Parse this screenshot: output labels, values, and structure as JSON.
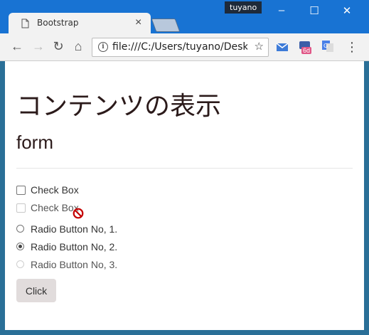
{
  "browser": {
    "tab_title": "Bootstrap",
    "tab_close": "×",
    "user_badge": "tuyano",
    "minimize": "–",
    "maximize": "☐",
    "close": "✕",
    "back": "←",
    "forward": "→",
    "reload": "↻",
    "home": "⌂",
    "url": "file:///C:/Users/tuyano/Desktop",
    "star": "☆",
    "ext_badge": "6d",
    "menu": "⋮"
  },
  "page": {
    "heading": "コンテンツの表示",
    "subheading": "form",
    "checkboxes": [
      {
        "label": "Check Box",
        "checked": false,
        "disabled": false
      },
      {
        "label": "Check Box",
        "checked": false,
        "disabled": true
      }
    ],
    "radios": [
      {
        "label": "Radio Button No, 1.",
        "checked": false,
        "disabled": false
      },
      {
        "label": "Radio Button No, 2.",
        "checked": true,
        "disabled": false
      },
      {
        "label": "Radio Button No, 3.",
        "checked": false,
        "disabled": true
      }
    ],
    "button_label": "Click"
  },
  "colors": {
    "titlebar": "#1873d3",
    "window_frame": "#2a6f97",
    "text": "#2b1a1a",
    "button_bg": "#e1dcdc"
  }
}
